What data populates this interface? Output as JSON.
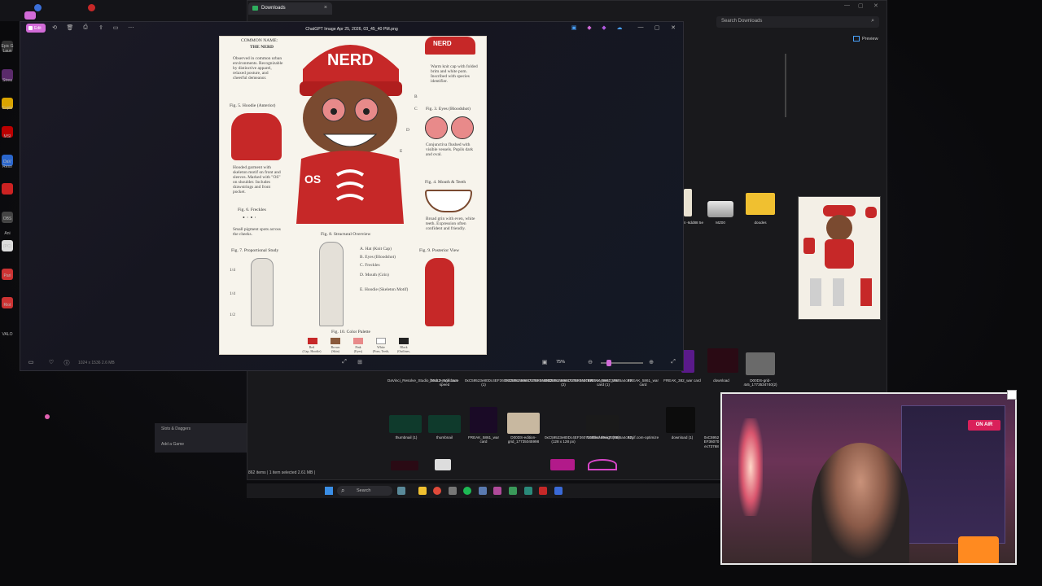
{
  "explorer": {
    "tab_title": "Downloads",
    "search_placeholder": "Search Downloads",
    "preview_label": "Preview",
    "status": "862 items  |  1 item selected  2.61 MB  |",
    "top_files": [
      {
        "name": "3c5d-4\n-6dd88\n5e"
      },
      {
        "name": "MZ00"
      },
      {
        "name": "doodes"
      }
    ],
    "row1": [
      {
        "name": "DaVinci_Resolve_Studio_20.3.2_Windows"
      },
      {
        "name": "freak2-ezgif.com-speed"
      },
      {
        "name": "0xC59523e80Dc4EF360702E9cA89ec737685a4cB2 (1)"
      },
      {
        "name": "0xC59523e80Dc4EF360702E9cA89ec737685a4cB2"
      },
      {
        "name": "0xC59523e80Dc4EF360702E9cA89ec737685a4cB2 (2)"
      },
      {
        "name": "FREAK_5861_war card (1)"
      },
      {
        "name": "FREAK_5861_war card"
      },
      {
        "name": "FREAK_382_war card"
      },
      {
        "name": "download"
      },
      {
        "name": "D00DS-grid-4x5_1773534740(2)"
      }
    ],
    "row2": [
      {
        "name": "thumbnail (1)"
      },
      {
        "name": "thumbnail"
      },
      {
        "name": "FREAK_5861_war card"
      },
      {
        "name": "D00DS-edition-grid_17735045998"
      },
      {
        "name": "0xC59523e80Dc4EF360702E9cA89ec737685a4cB2 (128 x 128 px)"
      },
      {
        "name": "Untitled design (66)"
      },
      {
        "name": "ezgif.com-optimize"
      },
      {
        "name": "download (1)"
      },
      {
        "name": "0xC5952 EF36070 ec73768"
      }
    ]
  },
  "viewer": {
    "title": "ChatGPT Image Apr 25, 2026, 03_45_40 PM.png",
    "edit_label": "Edit",
    "footer": "1024 x 1536   2.6 MB",
    "zoom_label": "75%",
    "zoom_level": 0.2
  },
  "sheet": {
    "common_name_label": "COMMON NAME:",
    "common_name": "THE NERD",
    "observed_text": "Observed in common urban environments. Recognizable by distinctive apparel, relaxed posture, and cheerful demeanor.",
    "hat_text": "NERD",
    "hat_note": "Warm knit cap with folded brim and white pom. Inscribed with species identifier.",
    "fig5": "Fig. 5. Hoodie (Anterior)",
    "fig5_note": "Hooded garment with skeleton motif on front and sleeves. Marked with \"OS\" on shoulder. Includes drawstrings and front pocket.",
    "fig3": "Fig. 3. Eyes (Bloodshot)",
    "fig3_note": "Conjunctiva flushed with visible vessels. Pupils dark and oval.",
    "fig4": "Fig. 4. Mouth & Teeth",
    "fig4_note": "Broad grin with even, white teeth. Expression often confident and friendly.",
    "fig6": "Fig. 6. Freckles",
    "fig6_note": "Small pigment spots across the cheeks.",
    "fig7": "Fig. 7. Proportional Study",
    "fig8": "Fig. 8. Structural Overview",
    "fig8_items": [
      "A. Hat (Knit Cap)",
      "B. Eyes (Bloodshot)",
      "C. Freckles",
      "D. Mouth (Grin)",
      "E. Hoodie (Skeleton Motif)"
    ],
    "fig9": "Fig. 9. Posterior View",
    "fig10": "Fig. 10. Color Palette",
    "palette": [
      {
        "label": "Red\n(Cap, Hoodie)",
        "color": "#c62828"
      },
      {
        "label": "Brown\n(Skin)",
        "color": "#8a5a3c"
      },
      {
        "label": "Pink\n(Eyes)",
        "color": "#e88a8a"
      },
      {
        "label": "White\n(Pom, Teeth,",
        "color": "#ffffff"
      },
      {
        "label": "Black\n(Outlines,",
        "color": "#222222"
      }
    ],
    "proportion_marks": [
      "1/4",
      "1/4",
      "1/2"
    ],
    "hood_mark": "OS",
    "callouts": [
      "B",
      "C",
      "D",
      "E"
    ]
  },
  "launcher": {
    "item1": "Slots & Daggers",
    "item2": "Add a Game"
  },
  "taskbar": {
    "search_label": "Search"
  },
  "desktop_labels": [
    "Epic G",
    "Laun",
    "Strea",
    "Explo",
    "MSI",
    "DaV",
    "Reso",
    "OBS",
    "Ani",
    "(PC)",
    "Pari",
    "Riot",
    "VALO"
  ],
  "webcam": {
    "sign": "ON AIR"
  }
}
